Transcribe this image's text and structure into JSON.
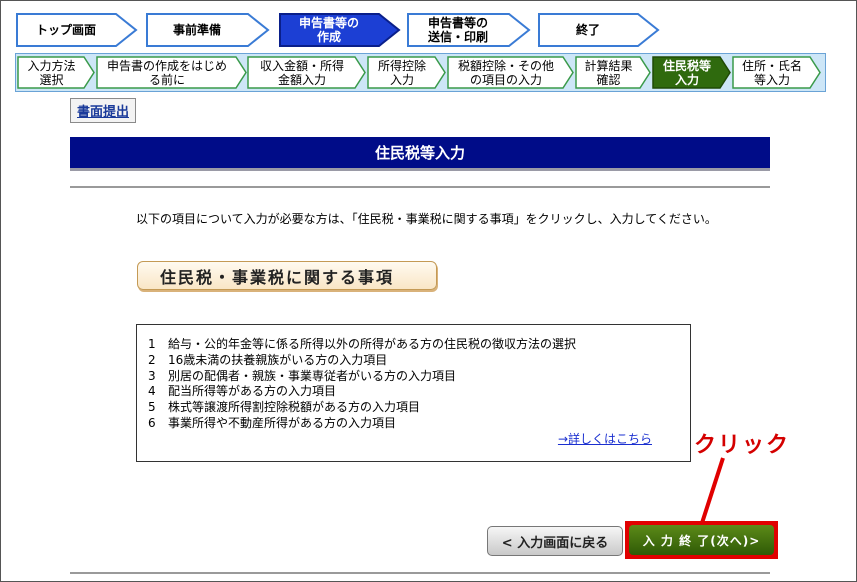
{
  "steps": [
    {
      "label": "トップ画面",
      "current": false
    },
    {
      "label": "事前準備",
      "current": false
    },
    {
      "label": "申告書等の\n作成",
      "current": true
    },
    {
      "label": "申告書等の\n送信・印刷",
      "current": false
    },
    {
      "label": "終了",
      "current": false
    }
  ],
  "substeps": [
    {
      "label": "入力方法\n選択",
      "current": false
    },
    {
      "label": "申告書の作成をはじめ\nる前に",
      "current": false
    },
    {
      "label": "収入金額・所得\n金額入力",
      "current": false
    },
    {
      "label": "所得控除\n入力",
      "current": false
    },
    {
      "label": "税額控除・その他\nの項目の入力",
      "current": false
    },
    {
      "label": "計算結果\n確認",
      "current": false
    },
    {
      "label": "住民税等\n入力",
      "current": true
    },
    {
      "label": "住所・氏名\n等入力",
      "current": false
    }
  ],
  "submit_link": "書面提出",
  "page_title": "住民税等入力",
  "intro_text": "　以下の項目について入力が必要な方は、「住民税・事業税に関する事項」をクリックし、入力してください。",
  "section_button": "住民税・事業税に関する事項",
  "items": [
    {
      "num": "1",
      "text": "給与・公的年金等に係る所得以外の所得がある方の住民税の徴収方法の選択"
    },
    {
      "num": "2",
      "text": "16歳未満の扶養親族がいる方の入力項目"
    },
    {
      "num": "3",
      "text": "別居の配偶者・親族・事業専従者がいる方の入力項目"
    },
    {
      "num": "4",
      "text": "配当所得等がある方の入力項目"
    },
    {
      "num": "5",
      "text": "株式等譲渡所得割控除税額がある方の入力項目"
    },
    {
      "num": "6",
      "text": "事業所得や不動産所得がある方の入力項目"
    }
  ],
  "more_link": "→詳しくはこちら",
  "annotation": "クリック",
  "back_button": "< 入力画面に戻る",
  "next_button": "入 力 終 了(次へ)>",
  "colors": {
    "title_bar": "#000c88",
    "current_step": "#1c3fd4",
    "current_substep": "#2f6a0e",
    "next_button": "#3f6d0c",
    "annotation": "#e00000"
  }
}
